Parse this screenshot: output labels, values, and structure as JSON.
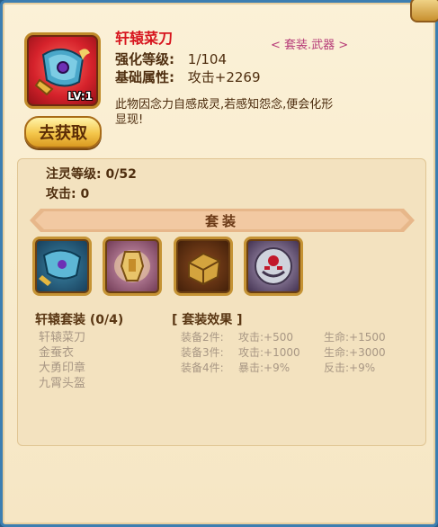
{
  "item": {
    "name": "轩辕菜刀",
    "level_badge": "LV:1",
    "type": "< 套装.武器 >",
    "enhance_label": "强化等级:",
    "enhance_value": "1/104",
    "base_label": "基础属性:",
    "base_value": "攻击+2269",
    "description": "此物因念力自感成灵,若感知怨念,便会化形显现!",
    "get_button": "去获取"
  },
  "refine": {
    "level": "注灵等级: 0/52",
    "attack": "攻击: 0"
  },
  "set": {
    "banner": "套装",
    "icons": [
      {
        "icon": "cleaver-weapon-icon"
      },
      {
        "icon": "golden-armor-icon"
      },
      {
        "icon": "seal-icon"
      },
      {
        "icon": "helmet-icon"
      }
    ],
    "title": "轩辕套装 (0/4)",
    "members": [
      "轩辕菜刀",
      "金蚕衣",
      "大勇印章",
      "九霄头盔"
    ],
    "effect_title": "[ 套装效果 ]",
    "effects": [
      {
        "req": "装备2件:",
        "stat1": "攻击:+500",
        "stat2": "生命:+1500"
      },
      {
        "req": "装备3件:",
        "stat1": "攻击:+1000",
        "stat2": "生命:+3000"
      },
      {
        "req": "装备4件:",
        "stat1": "暴击:+9%",
        "stat2": "反击:+9%"
      }
    ]
  },
  "colors": {
    "name_red": "#d7151e",
    "inactive_gray": "#a89784",
    "panel_bg": "#fbf1d7"
  }
}
